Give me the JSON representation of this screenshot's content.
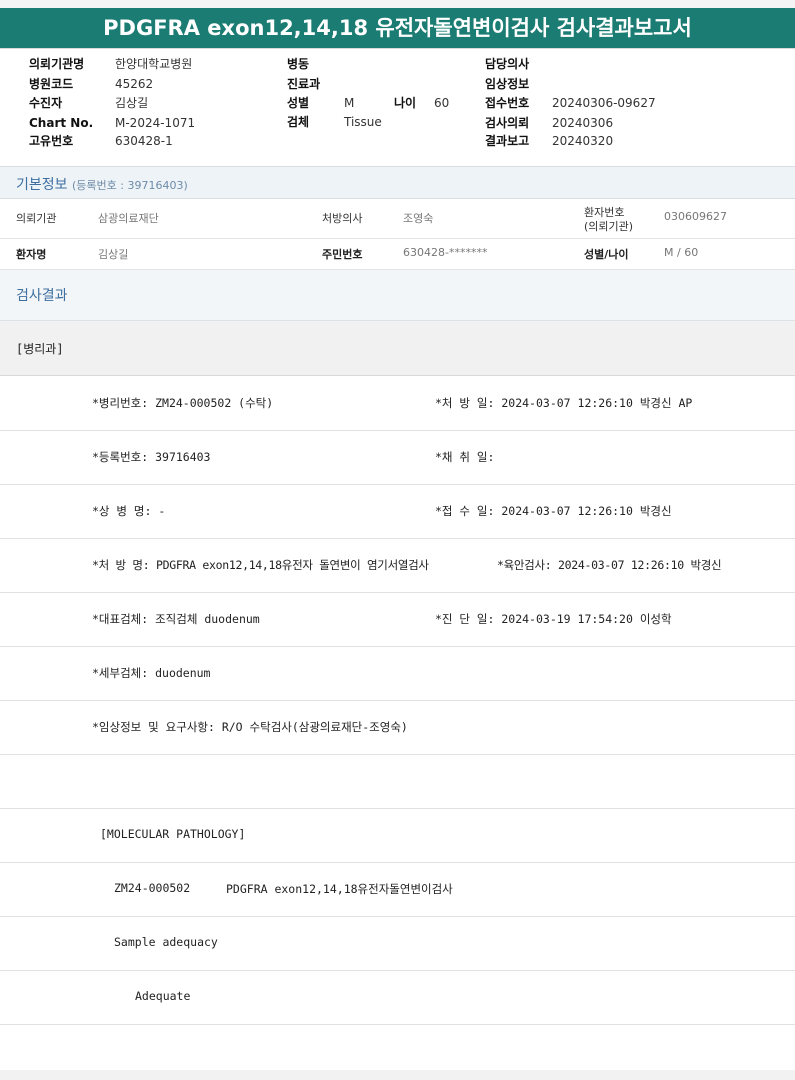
{
  "title": "PDGFRA exon12,14,18 유전자돌연변이검사 검사결과보고서",
  "header": {
    "left": [
      {
        "label": "의뢰기관명",
        "value": "한양대학교병원"
      },
      {
        "label": "병원코드",
        "value": "45262"
      },
      {
        "label": "수진자",
        "value": "김상길"
      },
      {
        "label": "Chart No.",
        "value": "M-2024-1071"
      },
      {
        "label": "고유번호",
        "value": "630428-1"
      }
    ],
    "mid": [
      {
        "label": "병동",
        "value": ""
      },
      {
        "label": "진료과",
        "value": ""
      },
      {
        "label": "성별",
        "value": "M"
      },
      {
        "label": "검체",
        "value": "Tissue"
      }
    ],
    "age_label": "나이",
    "age_value": "60",
    "right": [
      {
        "label": "담당의사",
        "value": ""
      },
      {
        "label": "임상정보",
        "value": ""
      },
      {
        "label": "접수번호",
        "value": "20240306-09627"
      },
      {
        "label": "검사의뢰",
        "value": "20240306"
      },
      {
        "label": "결과보고",
        "value": "20240320"
      }
    ]
  },
  "basic": {
    "title": "기본정보",
    "reg": "(등록번호 : 39716403)",
    "row1": [
      {
        "label": "의뢰기관",
        "value": "삼광의료재단"
      },
      {
        "label": "처방의사",
        "value": "조영숙"
      },
      {
        "label1": "환자번호",
        "label2": "(의뢰기관)",
        "value": "030609627"
      }
    ],
    "row2": [
      {
        "label": "환자명",
        "value": "김상길"
      },
      {
        "label": "주민번호",
        "value": "630428-*******"
      },
      {
        "label": "성별/나이",
        "value": "M / 60"
      }
    ]
  },
  "result_title": "검사결과",
  "dept": "[병리과]",
  "lines": [
    {
      "a": "*병리번호: ZM24-000502 (수탁)",
      "b": "*처 방 일: 2024-03-07 12:26:10  박경신 AP"
    },
    {
      "a": "*등록번호: 39716403",
      "b": "*채 취 일:"
    },
    {
      "a": "*상 병 명: -",
      "b": "*접 수 일: 2024-03-07 12:26:10  박경신"
    },
    {
      "a": "*처 방 명: PDGFRA exon12,14,18유전자 돌연변이 염기서열검사",
      "b": "*육안검사: 2024-03-07 12:26:10  박경신"
    },
    {
      "a": "*대표검체: 조직검체 duodenum",
      "b": "*진 단 일: 2024-03-19 17:54:20  이성학"
    },
    {
      "a": "*세부검체: duodenum",
      "b": ""
    },
    {
      "a": "*임상정보 및 요구사항: R/O 수탁검사(삼광의료재단-조영숙)",
      "b": ""
    }
  ],
  "molecular": {
    "heading": "[MOLECULAR PATHOLOGY]",
    "code": "ZM24-000502",
    "test": "PDGFRA exon12,14,18유전자돌연변이검사",
    "adequacy_label": "Sample adequacy",
    "adequacy_value": "Adequate"
  }
}
